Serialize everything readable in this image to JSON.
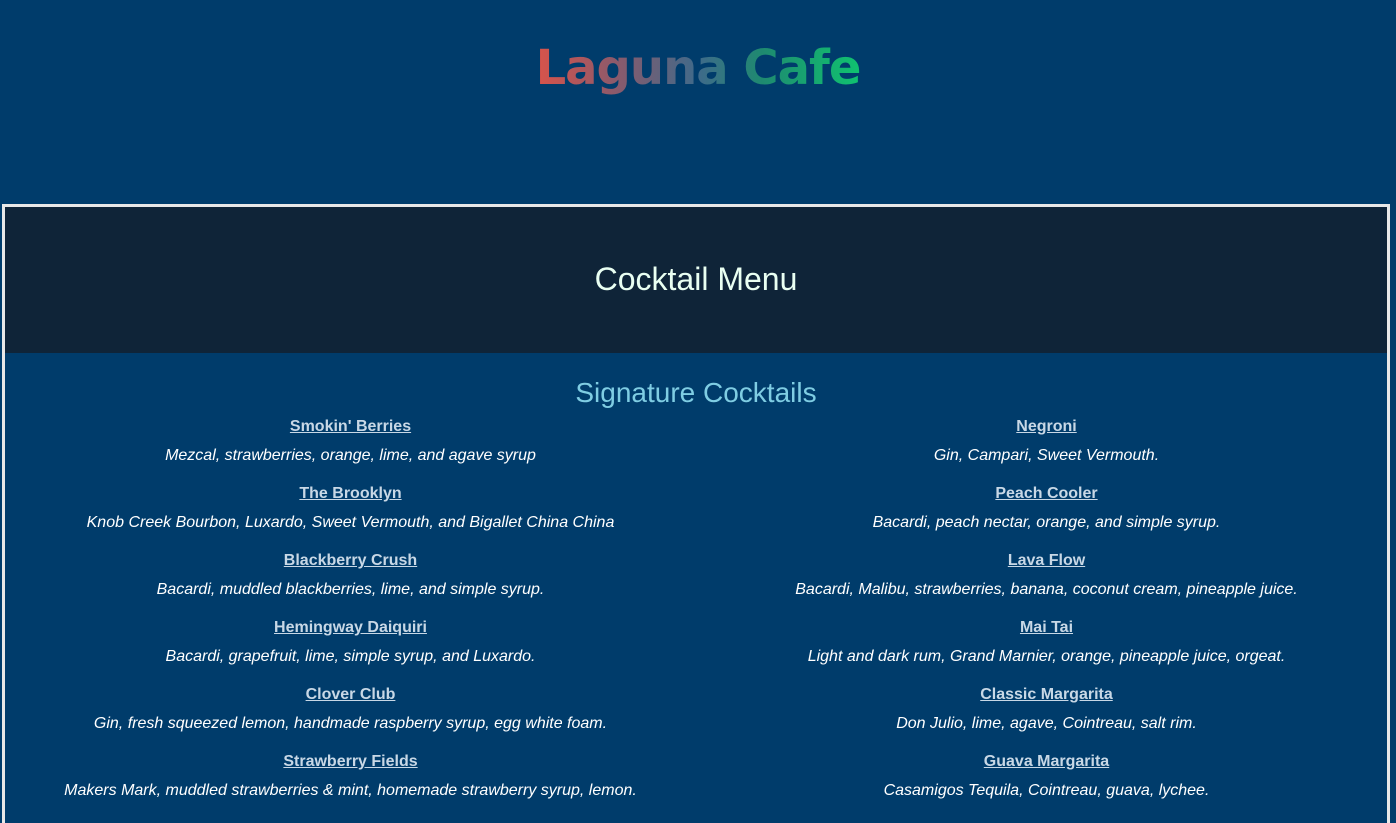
{
  "brand": {
    "name": "Laguna Cafe"
  },
  "page_title": "Cocktail Menu",
  "section": {
    "title": "Signature Cocktails",
    "left": [
      {
        "name": "Smokin' Berries",
        "desc": "Mezcal, strawberries, orange, lime, and agave syrup"
      },
      {
        "name": "The Brooklyn",
        "desc": "Knob Creek Bourbon, Luxardo, Sweet Vermouth, and Bigallet China China"
      },
      {
        "name": "Blackberry Crush",
        "desc": "Bacardi, muddled blackberries, lime, and simple syrup."
      },
      {
        "name": "Hemingway Daiquiri",
        "desc": "Bacardi, grapefruit, lime, simple syrup, and Luxardo."
      },
      {
        "name": "Clover Club",
        "desc": "Gin, fresh squeezed lemon, handmade raspberry syrup, egg white foam."
      },
      {
        "name": "Strawberry Fields",
        "desc": "Makers Mark, muddled strawberries & mint, homemade strawberry syrup, lemon."
      }
    ],
    "right": [
      {
        "name": "Negroni",
        "desc": "Gin, Campari, Sweet Vermouth."
      },
      {
        "name": "Peach Cooler",
        "desc": "Bacardi, peach nectar, orange, and simple syrup."
      },
      {
        "name": "Lava Flow",
        "desc": "Bacardi, Malibu, strawberries, banana, coconut cream, pineapple juice."
      },
      {
        "name": "Mai Tai",
        "desc": "Light and dark rum, Grand Marnier, orange, pineapple juice, orgeat."
      },
      {
        "name": "Classic Margarita",
        "desc": "Don Julio, lime, agave, Cointreau, salt rim."
      },
      {
        "name": "Guava Margarita",
        "desc": "Casamigos Tequila, Cointreau, guava, lychee."
      }
    ]
  },
  "colors": {
    "background": "#003c6b",
    "title_panel": "#0f2438",
    "section_title": "#7fcde3",
    "link": "#c8d8e6",
    "logo_gradient_start": "#d9534a",
    "logo_gradient_end": "#10c270"
  }
}
